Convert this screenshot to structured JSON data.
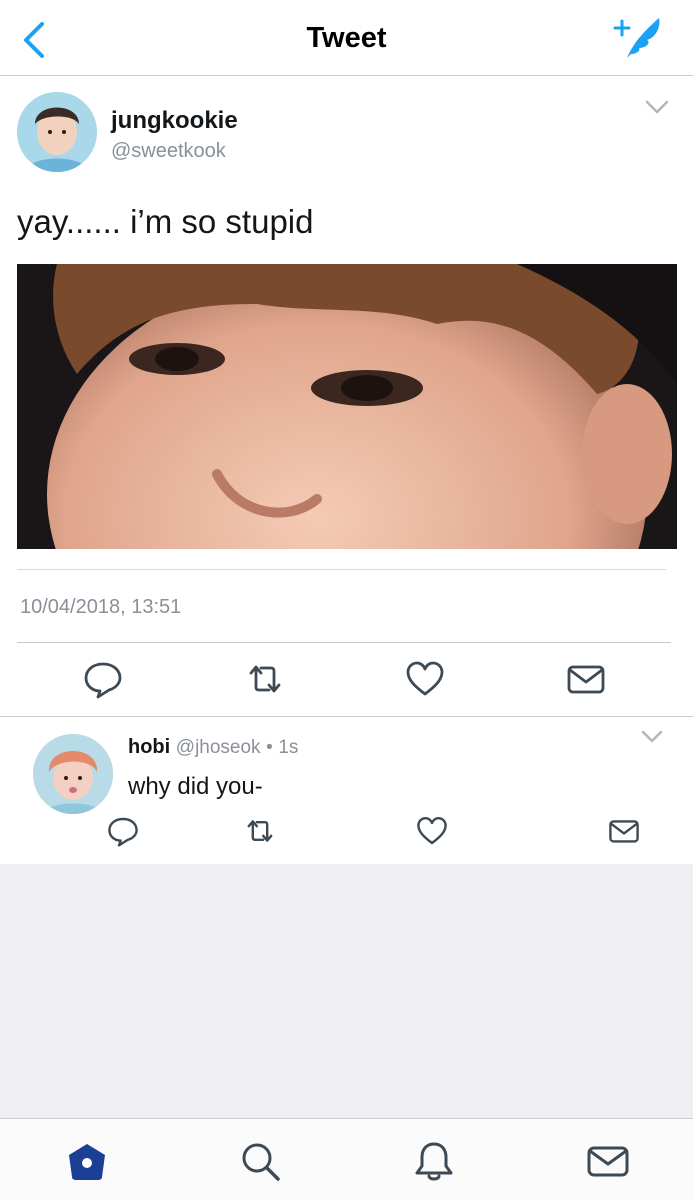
{
  "nav": {
    "title": "Tweet",
    "back_icon": "chevron-left-icon",
    "compose_icon": "compose-tweet-icon",
    "accent_color": "#1da1f2"
  },
  "tweet": {
    "author_name": "jungkookie",
    "author_handle": "@sweetkook",
    "text": "yay...... i’m so stupid",
    "timestamp": "10/04/2018, 13:51",
    "actions": [
      "reply-icon",
      "retweet-icon",
      "like-icon",
      "direct-message-icon"
    ]
  },
  "reply": {
    "author_name": "hobi",
    "author_handle": "@jhoseok",
    "separator": "•",
    "time": "1s",
    "text": "why did you-",
    "actions": [
      "reply-icon",
      "retweet-icon",
      "like-icon",
      "direct-message-icon"
    ]
  },
  "tabbar": {
    "items": [
      "home-icon",
      "search-icon",
      "notifications-icon",
      "messages-icon"
    ],
    "active": "home-icon",
    "active_color": "#1b3f94"
  }
}
